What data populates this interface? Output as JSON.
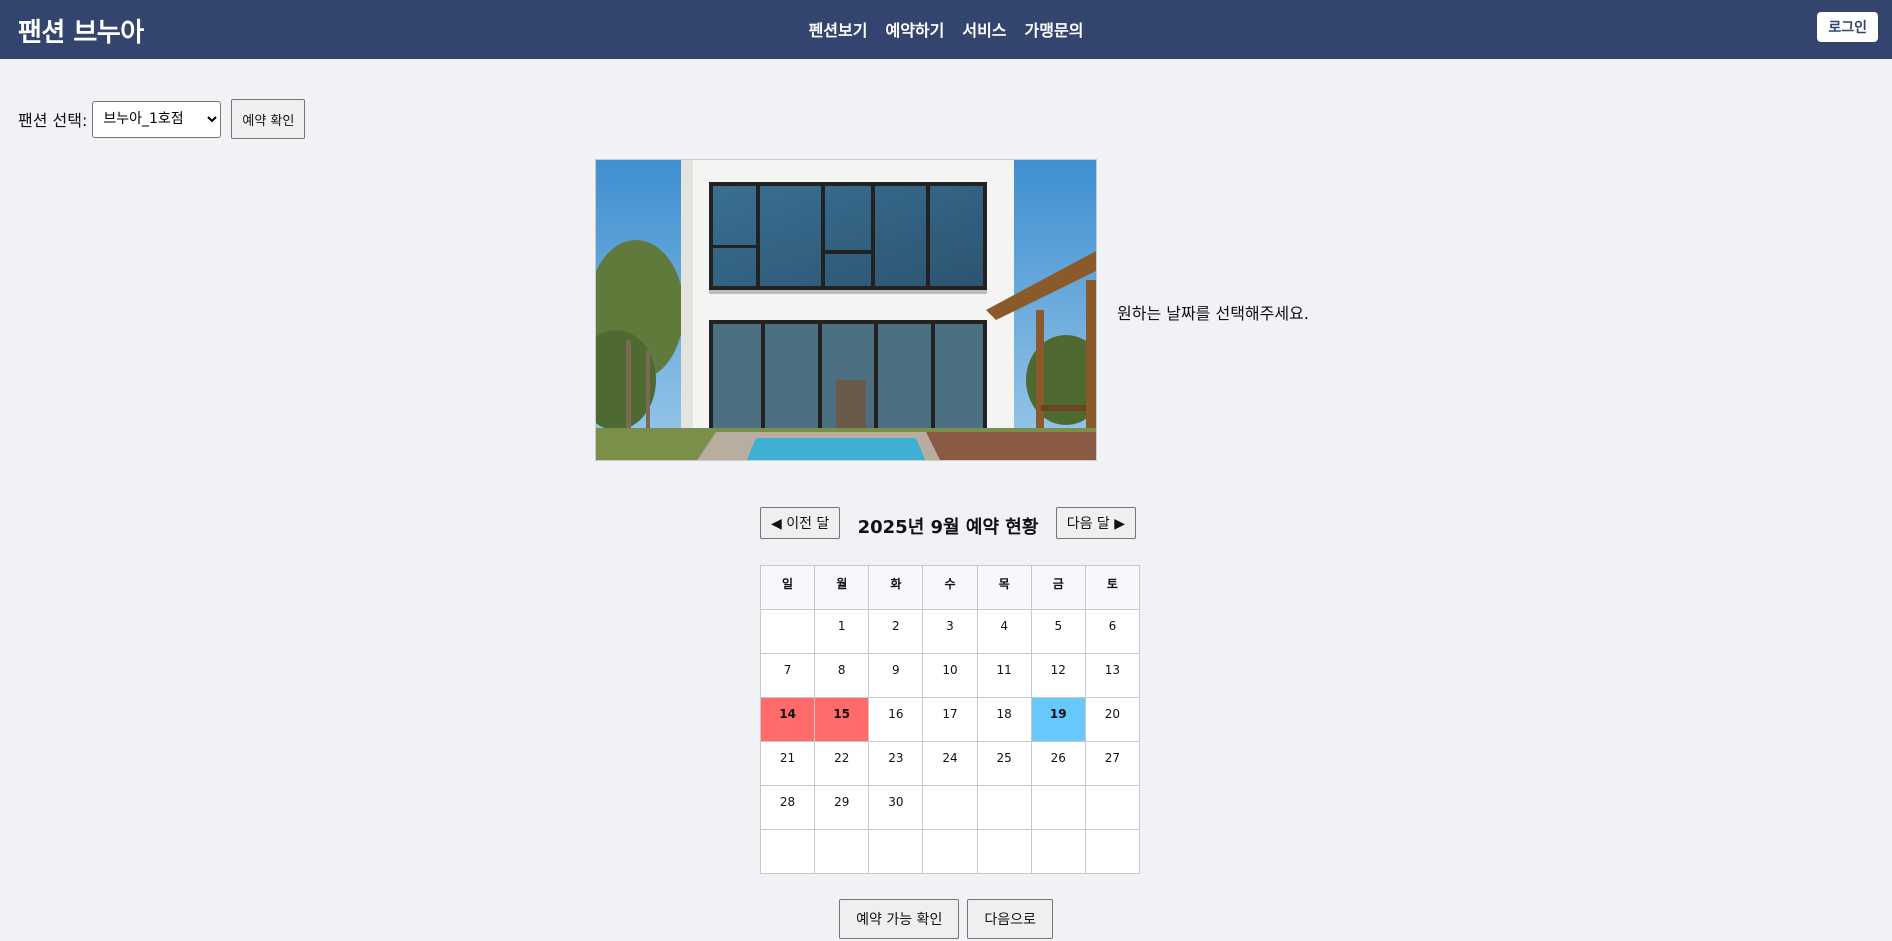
{
  "header": {
    "brand": "팬션 브누아",
    "nav": [
      "펜션보기",
      "예약하기",
      "서비스",
      "가맹문의"
    ],
    "login_label": "로그인"
  },
  "selector": {
    "label": "팬션 선택:",
    "selected": "브누아_1호점",
    "check_button": "예약 확인"
  },
  "photo": {
    "alt": "pension-house-photo"
  },
  "side_text": "원하는 날짜를 선택해주세요.",
  "calendar": {
    "prev_label": "◀ 이전 달",
    "next_label": "다음 달 ▶",
    "title": "2025년 9월 예약 현황",
    "weekdays": [
      "일",
      "월",
      "화",
      "수",
      "목",
      "금",
      "토"
    ],
    "weeks": [
      [
        "",
        "1",
        "2",
        "3",
        "4",
        "5",
        "6"
      ],
      [
        "7",
        "8",
        "9",
        "10",
        "11",
        "12",
        "13"
      ],
      [
        "14",
        "15",
        "16",
        "17",
        "18",
        "19",
        "20"
      ],
      [
        "21",
        "22",
        "23",
        "24",
        "25",
        "26",
        "27"
      ],
      [
        "28",
        "29",
        "30",
        "",
        "",
        "",
        ""
      ],
      [
        "",
        "",
        "",
        "",
        "",
        "",
        ""
      ]
    ],
    "booked_days": [
      "14",
      "15"
    ],
    "selected_days": [
      "19"
    ],
    "colors": {
      "booked": "#ff6b6b",
      "selected": "#66c8fb",
      "header_bar": "#33446e"
    }
  },
  "actions": {
    "check_available": "예약 가능 확인",
    "next": "다음으로"
  }
}
